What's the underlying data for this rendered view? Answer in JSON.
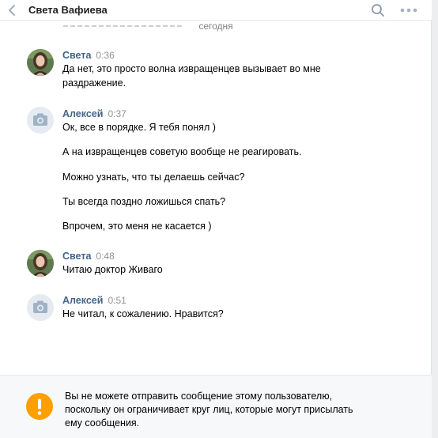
{
  "header": {
    "title": "Света Вафиева",
    "back_icon": "chevron-left-icon",
    "search_icon": "search-icon",
    "more_icon": "more-dots-icon"
  },
  "date_separator": "сегодня",
  "messages": [
    {
      "author": "Света",
      "time": "0:36",
      "avatar": "photo",
      "lines": [
        "Да нет, это просто волна извращенцев вызывает во мне",
        "раздражение."
      ]
    },
    {
      "author": "Алексей",
      "time": "0:37",
      "avatar": "camera-icon",
      "lines": [
        "Ок, все в порядке. Я тебя понял )",
        "А на извращенцев советую вообще не реагировать.",
        "Можно узнать, что ты делаешь сейчас?",
        "Ты всегда поздно ложишься спать?",
        "Впрочем, это меня не касается )"
      ]
    },
    {
      "author": "Света",
      "time": "0:48",
      "avatar": "photo",
      "lines": [
        "Читаю доктор Живаго"
      ]
    },
    {
      "author": "Алексей",
      "time": "0:51",
      "avatar": "camera-icon",
      "lines": [
        "Не читал, к сожалению. Нравится?"
      ]
    }
  ],
  "footer": {
    "icon": "warning-icon",
    "lines": [
      "Вы не можете отправить сообщение этому пользователю,",
      "поскольку он ограничивает круг лиц, которые могут присылать",
      "ему сообщения."
    ]
  },
  "colors": {
    "author": "#42648b",
    "warning": "#ffa000",
    "time": "#939393",
    "footer_bg": "#f7f8fa"
  }
}
